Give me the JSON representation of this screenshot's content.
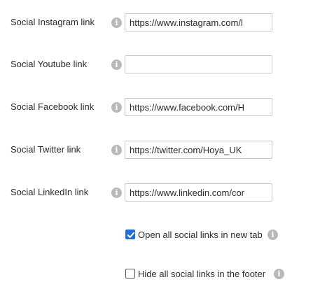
{
  "fields": [
    {
      "label": "Social Instagram link",
      "value": "https://www.instagram.com/l",
      "info_icon": "info-icon"
    },
    {
      "label": "Social Youtube link",
      "value": "",
      "info_icon": "info-icon"
    },
    {
      "label": "Social Facebook link",
      "value": "https://www.facebook.com/H",
      "info_icon": "info-icon"
    },
    {
      "label": "Social Twitter link",
      "value": "https://twitter.com/Hoya_UK",
      "info_icon": "info-icon"
    },
    {
      "label": "Social LinkedIn link",
      "value": "https://www.linkedin.com/cor",
      "info_icon": "info-icon"
    }
  ],
  "options": [
    {
      "label": "Open all social links in new tab",
      "checked": true,
      "info_icon": "info-icon"
    },
    {
      "label": "Hide all social links in the footer",
      "checked": false,
      "info_icon": "info-icon"
    }
  ],
  "colors": {
    "checkbox_accent": "#1f6fd6",
    "info_icon_bg": "#b9b9b9"
  }
}
